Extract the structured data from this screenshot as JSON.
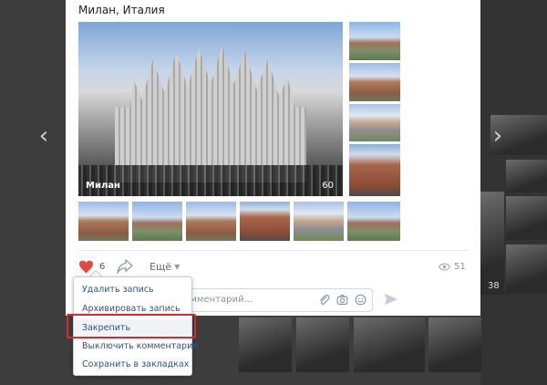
{
  "post": {
    "location": "Милан, Италия",
    "main_photo_caption": "Милан",
    "main_photo_count": "60",
    "likes": "6",
    "more_label": "Ещё",
    "views": "51",
    "comment_placeholder": "Написать комментарий..."
  },
  "menu": {
    "items": [
      "Удалить запись",
      "Архивировать запись",
      "Закрепить",
      "Выключить комментарии",
      "Сохранить в закладках"
    ]
  },
  "background": {
    "visible_text": "38"
  },
  "colors": {
    "like_red": "#e64646",
    "highlight_frame": "#e0262e",
    "menu_link": "#2a5885"
  },
  "icons": [
    "heart-icon",
    "share-icon",
    "chevron-down-icon",
    "eye-icon",
    "attach-icon",
    "camera-icon",
    "emoji-icon",
    "send-icon",
    "arrow-left-icon",
    "arrow-right-icon"
  ]
}
